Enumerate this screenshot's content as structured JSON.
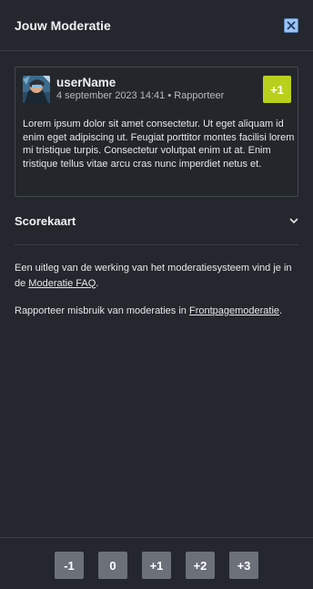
{
  "header": {
    "title": "Jouw Moderatie",
    "close_icon": "close-icon",
    "close_color": "#9cc4f2"
  },
  "post": {
    "username": "userName",
    "date": "4 september 2023 14:41",
    "separator": "•",
    "report_label": "Rapporteer",
    "score": "+1",
    "score_color": "#b9d01d",
    "body": "Lorem ipsum dolor sit amet consectetur. Ut eget aliquam id enim eget adipiscing ut. Feugiat porttitor montes facilisi lorem mi tristique turpis. Consectetur volutpat enim ut at. Enim tristique tellus vitae arcu cras nunc imperdiet netus et."
  },
  "scorekaart": {
    "label": "Scorekaart",
    "icon": "chevron-down-icon"
  },
  "info": {
    "p1_before": "Een uitleg van de werking van het moderatiesysteem vind je in de ",
    "p1_link": "Moderatie FAQ",
    "p1_after": ".",
    "p2_before": "Rapporteer misbruik van moderaties in ",
    "p2_link": "Frontpagemoderatie",
    "p2_after": "."
  },
  "votes": [
    "-1",
    "0",
    "+1",
    "+2",
    "+3"
  ]
}
